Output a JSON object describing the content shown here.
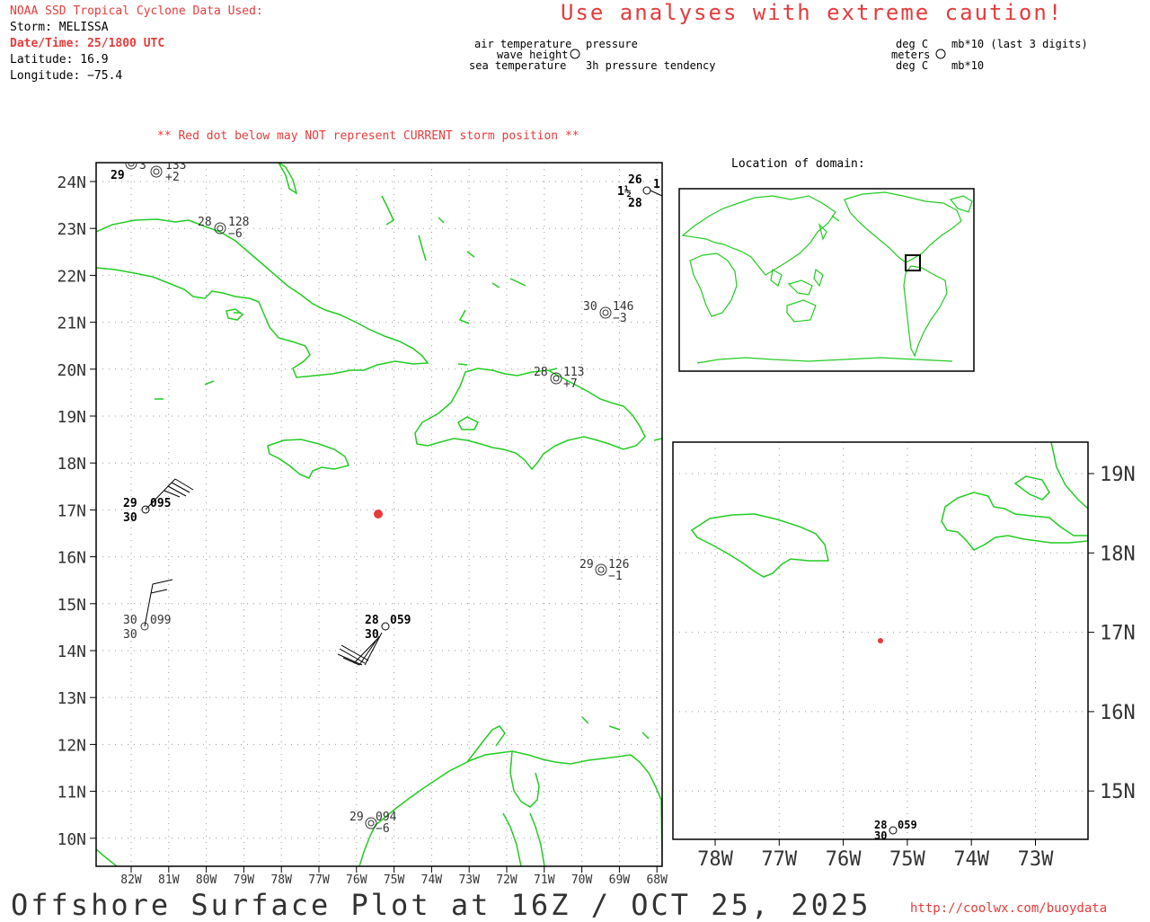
{
  "header": {
    "source": "NOAA SSD Tropical Cyclone Data Used:",
    "storm_label": "Storm: MELISSA",
    "datetime": "Date/Time: 25/1800 UTC",
    "latitude": "Latitude: 16.9",
    "longitude": "Longitude: −75.4",
    "caution": "Use analyses with extreme caution!"
  },
  "legend_left": {
    "air_temperature": "air temperature",
    "pressure": "pressure",
    "wave_height": "wave height",
    "sea_temperature": "sea temperature",
    "pressure_tendency": "3h pressure tendency"
  },
  "legend_right": {
    "deg_c_top": "deg C",
    "mb_top": "mb*10 (last 3 digits)",
    "meters": "meters",
    "deg_c_bottom": "deg C",
    "mb_bottom": "mb*10"
  },
  "warning": "** Red dot below may NOT represent CURRENT storm position **",
  "inset_title": "Location of domain:",
  "main_map": {
    "lat_labels": [
      "24N",
      "23N",
      "22N",
      "21N",
      "20N",
      "19N",
      "18N",
      "17N",
      "16N",
      "15N",
      "14N",
      "13N",
      "12N",
      "11N",
      "10N"
    ],
    "lon_labels": [
      "82W",
      "81W",
      "80W",
      "79W",
      "78W",
      "77W",
      "76W",
      "75W",
      "74W",
      "73W",
      "72W",
      "71W",
      "70W",
      "69W",
      "68W"
    ],
    "storm_position": {
      "lat": 16.9,
      "lon": -75.4
    },
    "stations": [
      {
        "air": "29",
        "pres": "095",
        "sea": "30",
        "tend": ""
      },
      {
        "air": "30",
        "pres": "099",
        "sea": "30",
        "tend": ""
      },
      {
        "air": "28",
        "pres": "059",
        "sea": "30",
        "tend": ""
      },
      {
        "air": "29",
        "pres": "094",
        "sea": "",
        "tend": "−6"
      },
      {
        "air": "29",
        "pres": "126",
        "sea": "",
        "tend": "−1"
      },
      {
        "air": "30",
        "pres": "146",
        "sea": "",
        "tend": "−3"
      },
      {
        "air": "28",
        "pres": "113",
        "sea": "",
        "tend": "+7"
      },
      {
        "air": "28",
        "pres": "128",
        "sea": "",
        "tend": "−6"
      },
      {
        "air": "3",
        "pres": "133",
        "sea": "29",
        "tend": "+2"
      },
      {
        "air": "26",
        "pres": "1",
        "sea": "28",
        "tend": "",
        "wave": "1½"
      }
    ]
  },
  "zoom_map": {
    "lat_labels": [
      "19N",
      "18N",
      "17N",
      "16N",
      "15N"
    ],
    "lon_labels": [
      "78W",
      "77W",
      "76W",
      "75W",
      "74W",
      "73W"
    ],
    "station": {
      "air": "28",
      "pres": "059",
      "sea": "30"
    }
  },
  "footer": {
    "title": "Offshore Surface Plot at 16Z / OCT 25, 2025",
    "url": "http://coolwx.com/buoydata"
  },
  "colors": {
    "land": "#22cc22",
    "storm": "#e53b3b",
    "accent": "#e53b3b",
    "grid": "#999999"
  }
}
